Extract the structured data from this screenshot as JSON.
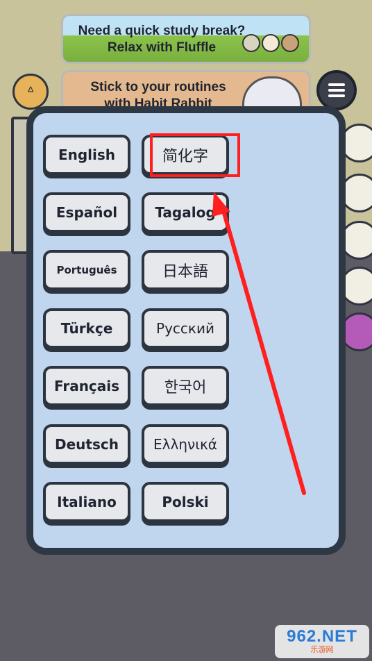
{
  "banners": {
    "study_break": "Need a quick study break?\nRelax with Fluffle",
    "habit_rabbit": "Stick to your routines\nwith Habit Rabbit"
  },
  "icons": {
    "coin": "rabbit-coin-icon",
    "menu": "hamburger-menu-icon"
  },
  "languages": [
    {
      "label": "English"
    },
    {
      "label": "简化字"
    },
    {
      "label": "Español"
    },
    {
      "label": "Tagalog"
    },
    {
      "label": "Português"
    },
    {
      "label": "日本語"
    },
    {
      "label": "Türkçe"
    },
    {
      "label": "Русский"
    },
    {
      "label": "Français"
    },
    {
      "label": "한국어"
    },
    {
      "label": "Deutsch"
    },
    {
      "label": "Ελληνικά"
    },
    {
      "label": "Italiano"
    },
    {
      "label": "Polski"
    }
  ],
  "annotation": {
    "color": "#ff1f1f",
    "highlighted_language": "简化字"
  },
  "watermark": {
    "main": "962.NET",
    "sub": "乐游网"
  }
}
